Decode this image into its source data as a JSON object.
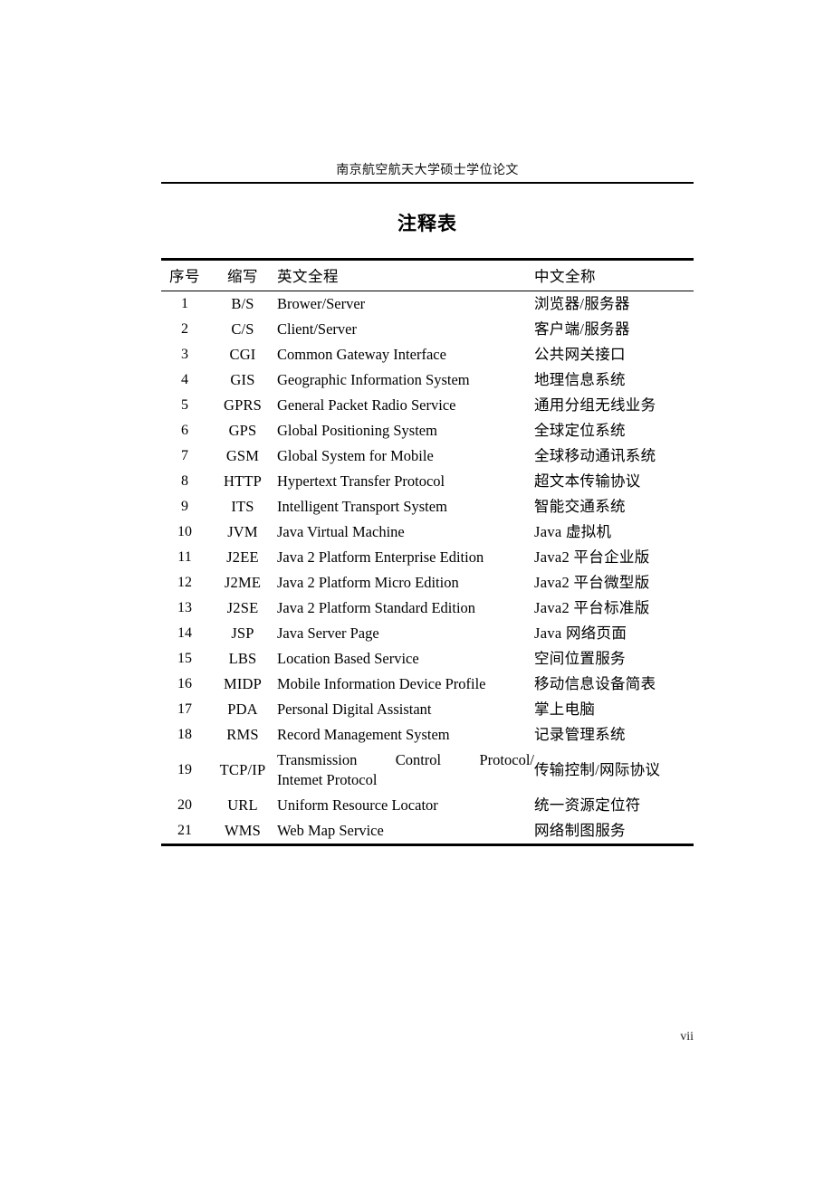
{
  "document": {
    "running_head": "南京航空航天大学硕士学位论文",
    "title": "注释表",
    "folio": "vii"
  },
  "table": {
    "headers": {
      "index": "序号",
      "abbreviation": "缩写",
      "english": "英文全程",
      "chinese": "中文全称"
    },
    "rows": [
      {
        "index": "1",
        "abbr": "B/S",
        "en": "Brower/Server",
        "zh": "浏览器/服务器"
      },
      {
        "index": "2",
        "abbr": "C/S",
        "en": "Client/Server",
        "zh": "客户端/服务器"
      },
      {
        "index": "3",
        "abbr": "CGI",
        "en": "Common Gateway Interface",
        "zh": "公共网关接口"
      },
      {
        "index": "4",
        "abbr": "GIS",
        "en": "Geographic Information System",
        "zh": "地理信息系统"
      },
      {
        "index": "5",
        "abbr": "GPRS",
        "en": "General Packet Radio Service",
        "zh": "通用分组无线业务"
      },
      {
        "index": "6",
        "abbr": "GPS",
        "en": "Global Positioning System",
        "zh": "全球定位系统"
      },
      {
        "index": "7",
        "abbr": "GSM",
        "en": "Global System for Mobile",
        "zh": "全球移动通讯系统"
      },
      {
        "index": "8",
        "abbr": "HTTP",
        "en": "Hypertext Transfer Protocol",
        "zh": "超文本传输协议"
      },
      {
        "index": "9",
        "abbr": "ITS",
        "en": "Intelligent Transport System",
        "zh": "智能交通系统"
      },
      {
        "index": "10",
        "abbr": "JVM",
        "en": "Java Virtual Machine",
        "zh": "Java 虚拟机"
      },
      {
        "index": "11",
        "abbr": "J2EE",
        "en": "Java 2 Platform Enterprise Edition",
        "zh": "Java2 平台企业版"
      },
      {
        "index": "12",
        "abbr": "J2ME",
        "en": "Java 2 Platform Micro Edition",
        "zh": "Java2 平台微型版"
      },
      {
        "index": "13",
        "abbr": "J2SE",
        "en": "Java 2 Platform Standard Edition",
        "zh": "Java2 平台标准版"
      },
      {
        "index": "14",
        "abbr": "JSP",
        "en": "Java Server Page",
        "zh": "Java 网络页面"
      },
      {
        "index": "15",
        "abbr": "LBS",
        "en": "Location Based Service",
        "zh": "空间位置服务"
      },
      {
        "index": "16",
        "abbr": "MIDP",
        "en": "Mobile Information Device Profile",
        "zh": "移动信息设备简表"
      },
      {
        "index": "17",
        "abbr": "PDA",
        "en": "Personal Digital Assistant",
        "zh": "掌上电脑"
      },
      {
        "index": "18",
        "abbr": "RMS",
        "en": "Record Management System",
        "zh": "记录管理系统"
      },
      {
        "index": "19",
        "abbr": "TCP/IP",
        "en_line1": "Transmission Control Protocol/",
        "en_line2": "Intemet Protocol",
        "zh": "传输控制/网际协议"
      },
      {
        "index": "20",
        "abbr": "URL",
        "en": "Uniform Resource Locator",
        "zh": "统一资源定位符"
      },
      {
        "index": "21",
        "abbr": "WMS",
        "en": "Web Map Service",
        "zh": "网络制图服务"
      }
    ]
  }
}
